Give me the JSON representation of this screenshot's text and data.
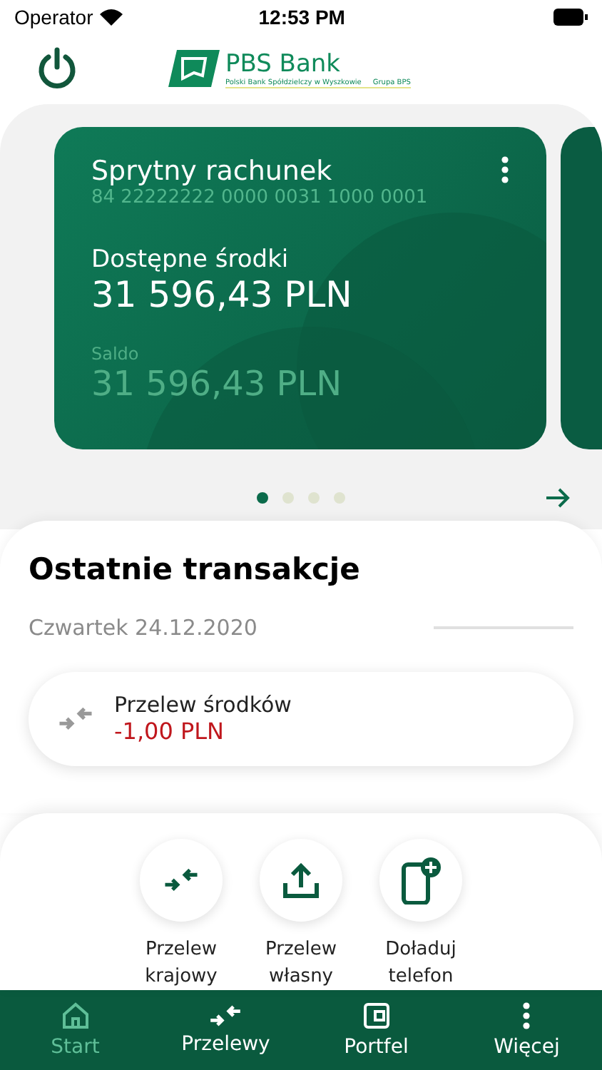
{
  "status_bar": {
    "carrier": "Operator",
    "time": "12:53 PM"
  },
  "header": {
    "logo": {
      "name": "PBS Bank",
      "subtitle": "Polski Bank Spółdzielczy w Wyszkowie",
      "group": "Grupa BPS"
    }
  },
  "account_card": {
    "name": "Sprytny rachunek",
    "number": "84 22222222 0000 0031 1000 0001",
    "available_label": "Dostępne środki",
    "available": "31 596,43 PLN",
    "balance_label": "Saldo",
    "balance": "31 596,43 PLN"
  },
  "carousel_dots": [
    {
      "selected": true
    },
    {
      "selected": false
    },
    {
      "selected": false
    },
    {
      "selected": false
    }
  ],
  "transactions": {
    "title": "Ostatnie transakcje",
    "date": "Czwartek 24.12.2020",
    "items": [
      {
        "title": "Przelew środków",
        "amount": "-1,00 PLN"
      }
    ]
  },
  "quick_actions": [
    {
      "kind": "transfer",
      "label": "Przelew krajowy"
    },
    {
      "kind": "upload",
      "label": "Przelew własny"
    },
    {
      "kind": "phone",
      "label": "Doładuj telefon"
    }
  ],
  "tab_bar": [
    {
      "kind": "home",
      "label": "Start",
      "selected": true
    },
    {
      "kind": "transfer",
      "label": "Przelewy",
      "selected": false
    },
    {
      "kind": "wallet",
      "label": "Portfel",
      "selected": false
    },
    {
      "kind": "more",
      "label": "Więcej",
      "selected": false
    }
  ]
}
